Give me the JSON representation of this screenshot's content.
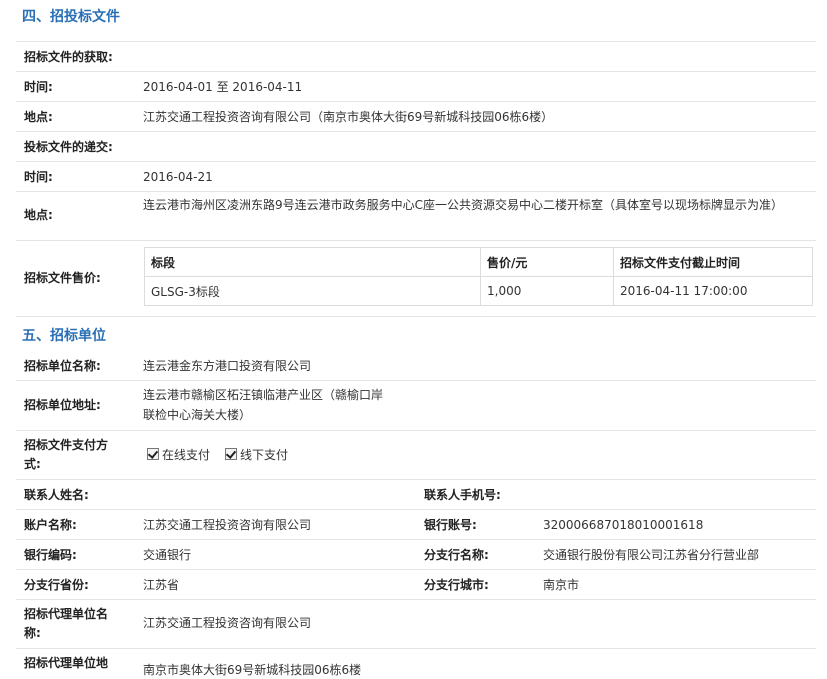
{
  "section4": {
    "title": "四、招投标文件",
    "obtain_label": "招标文件的获取:",
    "obtain_time_label": "时间:",
    "obtain_time_start": "2016-04-01",
    "obtain_time_sep": "至",
    "obtain_time_end": "2016-04-11",
    "obtain_place_label": "地点:",
    "obtain_place": "江苏交通工程投资咨询有限公司（南京市奥体大街69号新城科技园06栋6楼）",
    "submit_label": "投标文件的递交:",
    "submit_time_label": "时间:",
    "submit_time": "2016-04-21",
    "submit_place_label": "地点:",
    "submit_place": "连云港市海州区凌洲东路9号连云港市政务服务中心C座一公共资源交易中心二楼开标室（具体室号以现场标牌显示为准）",
    "price_label": "招标文件售价:",
    "price_table": {
      "headers": [
        "标段",
        "售价/元",
        "招标文件支付截止时间"
      ],
      "rows": [
        [
          "GLSG-3标段",
          "1,000",
          "2016-04-11 17:00:00"
        ]
      ]
    }
  },
  "section5": {
    "title": "五、招标单位",
    "unit_name_label": "招标单位名称:",
    "unit_name": "连云港金东方港口投资有限公司",
    "unit_addr_label": "招标单位地址:",
    "unit_addr_line1": "连云港市赣榆区柘汪镇临港产业区（赣榆口岸",
    "unit_addr_line2": "联检中心海关大楼）",
    "pay_method_label_line1": "招标文件支付方",
    "pay_method_label_line2": "式:",
    "pay_online": "在线支付",
    "pay_offline": "线下支付",
    "contact_name_label": "联系人姓名:",
    "contact_name": "",
    "contact_phone_label": "联系人手机号:",
    "contact_phone": "",
    "account_name_label": "账户名称:",
    "account_name": "江苏交通工程投资咨询有限公司",
    "bank_account_label": "银行账号:",
    "bank_account": "320006687018010001618",
    "bank_code_label": "银行编码:",
    "bank_code": "交通银行",
    "branch_name_label": "分支行名称:",
    "branch_name": "交通银行股份有限公司江苏省分行营业部",
    "branch_province_label": "分支行省份:",
    "branch_province": "江苏省",
    "branch_city_label": "分支行城市:",
    "branch_city": "南京市",
    "agent_name_label_line1": "招标代理单位名",
    "agent_name_label_line2": "称:",
    "agent_name": "江苏交通工程投资咨询有限公司",
    "agent_addr_label_line1": "招标代理单位地",
    "agent_addr": "南京市奥体大街69号新城科技园06栋6楼"
  }
}
